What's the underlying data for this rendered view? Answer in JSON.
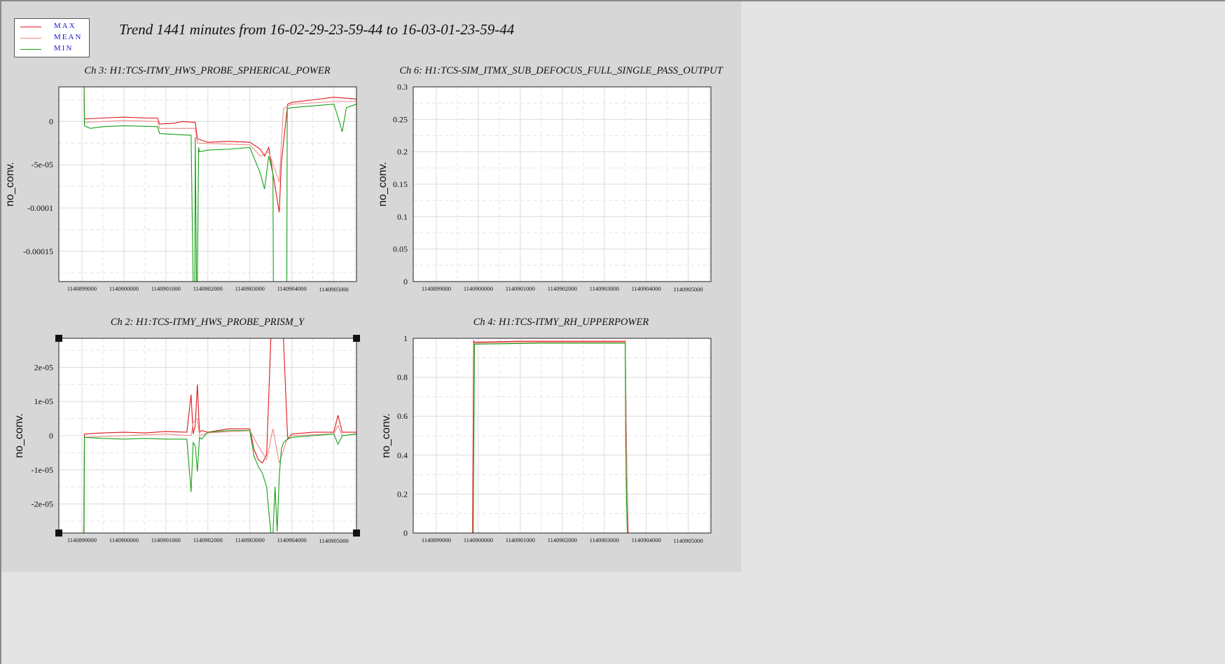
{
  "title": "Trend 1441 minutes from 16-02-29-23-59-44 to 16-03-01-23-59-44",
  "legend": [
    {
      "label": "MAX",
      "color": "#e0161b"
    },
    {
      "label": "MEAN",
      "color": "#f08a8a"
    },
    {
      "label": "MIN",
      "color": "#16a016"
    }
  ],
  "chart_data": [
    {
      "type": "line",
      "title": "Ch 3: H1:TCS-ITMY_HWS_PROBE_SPHERICAL_POWER",
      "ylabel": "no_conv.",
      "yticks": [
        "0",
        "-5e-05",
        "-0.0001",
        "-0.00015"
      ],
      "ytick_values": [
        0,
        -5e-05,
        -0.0001,
        -0.00015
      ],
      "ylim": [
        -0.000185,
        4e-05
      ],
      "xticks": [
        "1140899000",
        "1140900000",
        "1140901000",
        "1140902000",
        "1140903000",
        "1140904000",
        "1140905000"
      ],
      "xtick_values": [
        1140899000,
        1140900000,
        1140901000,
        1140902000,
        1140903000,
        1140904000,
        1140905000
      ],
      "xlim": [
        1140898450,
        1140905540
      ],
      "grid": true,
      "series": [
        {
          "name": "MAX",
          "x": [
            1140899050,
            1140899060,
            1140899100,
            1140899500,
            1140900000,
            1140900500,
            1140900800,
            1140900850,
            1140901200,
            1140901400,
            1140901700,
            1140901750,
            1140902000,
            1140902500,
            1140903000,
            1140903250,
            1140903350,
            1140903450,
            1140903550,
            1140903700,
            1140903750,
            1140903900,
            1140904000,
            1140904500,
            1140905000,
            1140905540
          ],
          "y": [
            4e-05,
            3e-06,
            3e-06,
            4e-06,
            5e-06,
            4e-06,
            4e-06,
            -3e-06,
            -2e-06,
            0.0,
            -1e-06,
            -2e-05,
            -2.4e-05,
            -2.3e-05,
            -2.4e-05,
            -3.2e-05,
            -4e-05,
            -3e-05,
            -6e-05,
            -0.000105,
            -4.8e-05,
            2e-05,
            2.2e-05,
            2.5e-05,
            2.8e-05,
            2.6e-05
          ]
        },
        {
          "name": "MEAN",
          "x": [
            1140899050,
            1140899060,
            1140899500,
            1140900000,
            1140900800,
            1140900850,
            1140901700,
            1140901750,
            1140903000,
            1140903250,
            1140903450,
            1140903700,
            1140903800,
            1140904000,
            1140905000,
            1140905540
          ],
          "y": [
            4e-05,
            -1e-06,
            0.0,
            1e-06,
            0.0,
            -8e-06,
            -8e-06,
            -2.5e-05,
            -2.7e-05,
            -4e-05,
            -3.5e-05,
            -7e-05,
            1.5e-05,
            2e-05,
            2.3e-05,
            2.3e-05
          ]
        },
        {
          "name": "MIN",
          "x": [
            1140899050,
            1140899060,
            1140899200,
            1140899500,
            1140900000,
            1140900800,
            1140900850,
            1140901600,
            1140901650,
            1140901690,
            1140901700,
            1140901730,
            1140901750,
            1140901780,
            1140901800,
            1140902000,
            1140902500,
            1140903000,
            1140903250,
            1140903350,
            1140903450,
            1140903550,
            1140903560,
            1140903570,
            1140903800,
            1140903880,
            1140903890,
            1140904000,
            1140904500,
            1140905000,
            1140905100,
            1140905200,
            1140905300,
            1140905540
          ],
          "y": [
            4e-05,
            -5e-06,
            -8e-06,
            -6e-06,
            -5e-06,
            -6e-06,
            -1.4e-05,
            -1.6e-05,
            -0.000185,
            -0.000185,
            -1.8e-05,
            -0.000185,
            -0.000185,
            -3e-05,
            -3.5e-05,
            -3.3e-05,
            -3.2e-05,
            -3e-05,
            -6e-05,
            -7.8e-05,
            -4e-05,
            -6e-05,
            -0.000185,
            -0.000185,
            -0.000185,
            -0.000185,
            1.5e-05,
            1.6e-05,
            1.8e-05,
            2e-05,
            5e-06,
            -1.2e-05,
            1.6e-05,
            2e-05
          ]
        }
      ]
    },
    {
      "type": "line",
      "title": "Ch 6: H1:TCS-SIM_ITMX_SUB_DEFOCUS_FULL_SINGLE_PASS_OUTPUT",
      "ylabel": "no_conv.",
      "yticks": [
        "0.3",
        "0.25",
        "0.2",
        "0.15",
        "0.1",
        "0.05",
        "0"
      ],
      "ytick_values": [
        0.3,
        0.25,
        0.2,
        0.15,
        0.1,
        0.05,
        0
      ],
      "ylim": [
        0,
        0.3
      ],
      "xticks": [
        "1140899000",
        "1140900000",
        "1140901000",
        "1140902000",
        "1140903000",
        "1140904000",
        "1140905000"
      ],
      "xtick_values": [
        1140899000,
        1140900000,
        1140901000,
        1140902000,
        1140903000,
        1140904000,
        1140905000
      ],
      "xlim": [
        1140898450,
        1140905540
      ],
      "grid": true,
      "series": []
    },
    {
      "type": "line",
      "title": "Ch 2: H1:TCS-ITMY_HWS_PROBE_PRISM_Y",
      "ylabel": "no_conv.",
      "yticks": [
        "2e-05",
        "1e-05",
        "0",
        "-1e-05",
        "-2e-05"
      ],
      "ytick_values": [
        2e-05,
        1e-05,
        0,
        -1e-05,
        -2e-05
      ],
      "ylim": [
        -2.85e-05,
        2.85e-05
      ],
      "xticks": [
        "1140899000",
        "1140900000",
        "1140901000",
        "1140902000",
        "1140903000",
        "1140904000",
        "1140905000"
      ],
      "xtick_values": [
        1140899000,
        1140900000,
        1140901000,
        1140902000,
        1140903000,
        1140904000,
        1140905000
      ],
      "xlim": [
        1140898450,
        1140905540
      ],
      "grid": true,
      "series": [
        {
          "name": "MAX",
          "x": [
            1140899040,
            1140899060,
            1140899500,
            1140900000,
            1140900500,
            1140901000,
            1140901500,
            1140901600,
            1140901650,
            1140901700,
            1140901750,
            1140901800,
            1140901850,
            1140902000,
            1140902500,
            1140903000,
            1140903100,
            1140903200,
            1140903300,
            1140903400,
            1140903500,
            1140903560,
            1140903800,
            1140903900,
            1140904000,
            1140904500,
            1140905000,
            1140905100,
            1140905200,
            1140905540
          ],
          "y": [
            -2.85e-05,
            5e-07,
            8e-07,
            1e-06,
            8e-07,
            1.2e-06,
            1e-06,
            1.2e-05,
            5e-07,
            3e-06,
            1.5e-05,
            1e-06,
            1.5e-06,
            1e-06,
            2e-06,
            2e-06,
            -4e-06,
            -7e-06,
            -8e-06,
            -5.5e-06,
            2.85e-05,
            2.85e-05,
            2.85e-05,
            -1e-06,
            5e-07,
            1e-06,
            1e-06,
            6e-06,
            1e-06,
            1e-06
          ]
        },
        {
          "name": "MEAN",
          "x": [
            1140899040,
            1140899060,
            1140900000,
            1140901000,
            1140901600,
            1140901650,
            1140901750,
            1140901800,
            1140902000,
            1140903000,
            1140903200,
            1140903400,
            1140903550,
            1140903700,
            1140903900,
            1140904000,
            1140905000,
            1140905100,
            1140905200,
            1140905540
          ],
          "y": [
            -2.85e-05,
            -5e-07,
            0.0,
            5e-07,
            0.0,
            4e-06,
            5e-06,
            0.0,
            8e-07,
            1.5e-06,
            -3e-06,
            -7e-06,
            2e-06,
            -8e-06,
            -5e-07,
            0.0,
            5e-07,
            3e-06,
            0.0,
            5e-07
          ]
        },
        {
          "name": "MIN",
          "x": [
            1140899040,
            1140899050,
            1140899060,
            1140899500,
            1140900000,
            1140900500,
            1140901000,
            1140901500,
            1140901600,
            1140901650,
            1140901700,
            1140901750,
            1140901800,
            1140901850,
            1140902000,
            1140902500,
            1140903000,
            1140903100,
            1140903200,
            1140903300,
            1140903400,
            1140903450,
            1140903500,
            1140903550,
            1140903600,
            1140903650,
            1140903700,
            1140903750,
            1140903800,
            1140903900,
            1140904000,
            1140904500,
            1140905000,
            1140905100,
            1140905200,
            1140905540
          ],
          "y": [
            -2.85e-05,
            -2.85e-05,
            -5e-07,
            -8e-07,
            -1e-06,
            -8e-07,
            -1e-06,
            -1e-06,
            -1.65e-05,
            -2e-06,
            -3e-06,
            -1.05e-05,
            -5e-07,
            -1e-06,
            1e-06,
            1.5e-06,
            1.5e-06,
            -6e-06,
            -9e-06,
            -1.1e-05,
            -1.5e-05,
            -2.2e-05,
            -2.85e-05,
            -2.85e-05,
            -1.5e-05,
            -2.8e-05,
            -1.2e-05,
            -4e-06,
            -2e-06,
            -1e-06,
            -5e-07,
            0.0,
            5e-07,
            -2.5e-06,
            0.0,
            5e-07
          ]
        }
      ]
    },
    {
      "type": "line",
      "title": "Ch 4: H1:TCS-ITMY_RH_UPPERPOWER",
      "ylabel": "no_conv.",
      "yticks": [
        "1",
        "0.8",
        "0.6",
        "0.4",
        "0.2",
        "0"
      ],
      "ytick_values": [
        1,
        0.8,
        0.6,
        0.4,
        0.2,
        0
      ],
      "ylim": [
        0,
        1
      ],
      "xticks": [
        "1140899000",
        "1140900000",
        "1140901000",
        "1140902000",
        "1140903000",
        "1140904000",
        "1140905000"
      ],
      "xtick_values": [
        1140899000,
        1140900000,
        1140901000,
        1140902000,
        1140903000,
        1140904000,
        1140905000
      ],
      "xlim": [
        1140898450,
        1140905540
      ],
      "grid": true,
      "series": [
        {
          "name": "MAX",
          "x": [
            1140899860,
            1140899890,
            1140899900,
            1140901000,
            1140902000,
            1140903000,
            1140903500,
            1140903520,
            1140903540,
            1140903560,
            1140903570
          ],
          "y": [
            0.0,
            0.99,
            0.98,
            0.985,
            0.985,
            0.985,
            0.985,
            0.6,
            0.3,
            0.1,
            0.0
          ]
        },
        {
          "name": "MEAN",
          "x": [
            1140899870,
            1140899900,
            1140900500,
            1140901500,
            1140902500,
            1140903500,
            1140903530,
            1140903560
          ],
          "y": [
            0.0,
            0.975,
            0.978,
            0.98,
            0.98,
            0.98,
            0.4,
            0.0
          ]
        },
        {
          "name": "MIN",
          "x": [
            1140899880,
            1140899910,
            1140900500,
            1140901500,
            1140902500,
            1140903500,
            1140903510,
            1140903530,
            1140903550
          ],
          "y": [
            0.0,
            0.97,
            0.972,
            0.975,
            0.975,
            0.975,
            0.5,
            0.15,
            0.0
          ]
        }
      ]
    }
  ]
}
